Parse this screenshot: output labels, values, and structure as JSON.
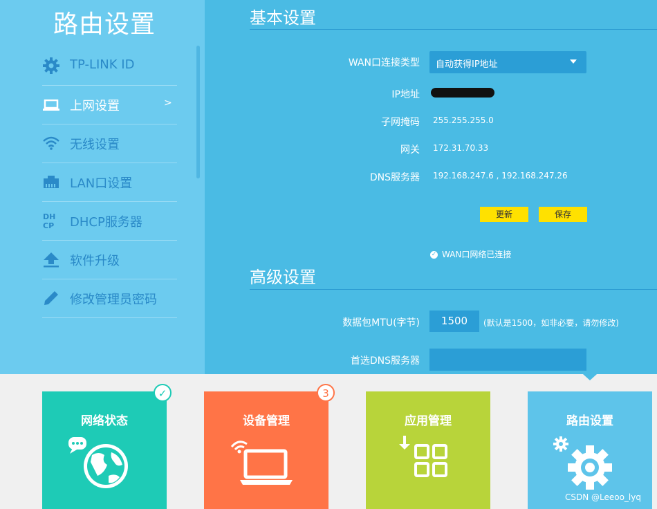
{
  "sidebar": {
    "title": "路由设置",
    "items": [
      {
        "label": "TP-LINK ID",
        "icon": "gear-icon"
      },
      {
        "label": "上网设置",
        "icon": "laptop-icon",
        "arrow": ">"
      },
      {
        "label": "无线设置",
        "icon": "wifi-icon"
      },
      {
        "label": "LAN口设置",
        "icon": "ethernet-port-icon"
      },
      {
        "label": "DHCP服务器",
        "icon": "dhcp-icon",
        "icon_text": "DH\nCP"
      },
      {
        "label": "软件升级",
        "icon": "upload-icon"
      },
      {
        "label": "修改管理员密码",
        "icon": "pencil-icon"
      }
    ]
  },
  "basic": {
    "title": "基本设置",
    "wan_type_label": "WAN口连接类型",
    "wan_type_value": "自动获得IP地址",
    "ip_label": "IP地址",
    "subnet_label": "子网掩码",
    "subnet_value": "255.255.255.0",
    "gateway_label": "网关",
    "gateway_value": "172.31.70.33",
    "dns_label": "DNS服务器",
    "dns_value": "192.168.247.6 , 192.168.247.26",
    "refresh_label": "更新",
    "save_label": "保存",
    "status_text": "WAN口网络已连接"
  },
  "advanced": {
    "title": "高级设置",
    "mtu_label": "数据包MTU(字节)",
    "mtu_value": "1500",
    "mtu_hint": "(默认是1500，如非必要，请勿修改)",
    "dns_label": "首选DNS服务器"
  },
  "tiles": [
    {
      "label": "网络状态",
      "icon": "globe-chat-icon",
      "color": "#1ecbb6"
    },
    {
      "label": "设备管理",
      "icon": "laptop-wifi-icon",
      "color": "#ff7447",
      "badge": "3"
    },
    {
      "label": "应用管理",
      "icon": "app-grid-icon",
      "color": "#b8d43a"
    },
    {
      "label": "路由设置",
      "icon": "gears-icon",
      "color": "#5ec4ea"
    }
  ],
  "watermark": "CSDN @Leeoo_lyq",
  "colors": {
    "accent_yellow": "#ffe100",
    "main_bg": "#4abbe4",
    "sidebar_bg": "#6ccbef"
  }
}
